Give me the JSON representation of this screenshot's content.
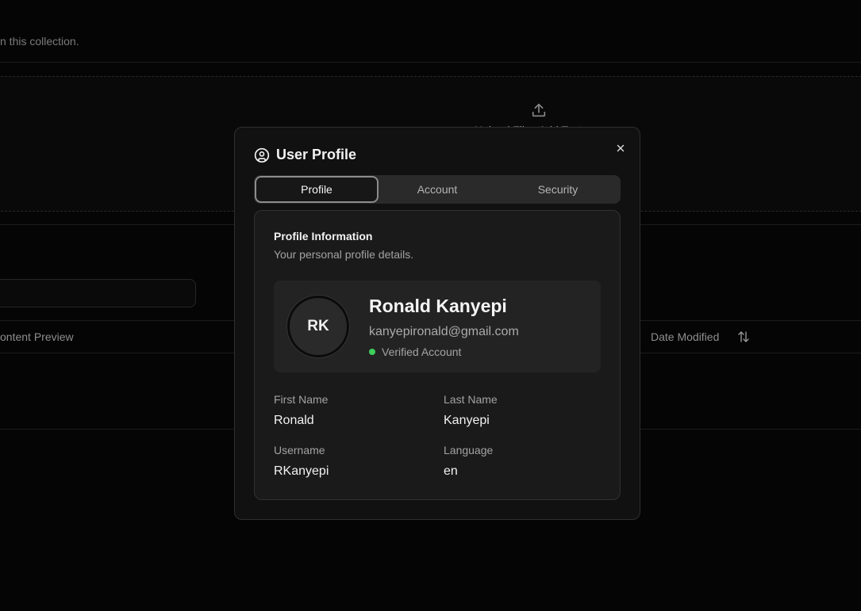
{
  "background": {
    "collection_description": "n this collection.",
    "upload_text": "Upload Files    Add Text",
    "table_headers": {
      "content_preview": "ontent Preview",
      "date_modified": "Date Modified"
    }
  },
  "modal": {
    "title": "User Profile",
    "tabs": [
      {
        "label": "Profile",
        "active": true
      },
      {
        "label": "Account",
        "active": false
      },
      {
        "label": "Security",
        "active": false
      }
    ],
    "card": {
      "title": "Profile Information",
      "description": "Your personal profile details.",
      "avatar_initials": "RK",
      "full_name": "Ronald Kanyepi",
      "email": "kanyepironald@gmail.com",
      "verification_status": "Verified Account",
      "fields": {
        "first_name": {
          "label": "First Name",
          "value": "Ronald"
        },
        "last_name": {
          "label": "Last Name",
          "value": "Kanyepi"
        },
        "username": {
          "label": "Username",
          "value": "RKanyepi"
        },
        "language": {
          "label": "Language",
          "value": "en"
        }
      }
    }
  },
  "colors": {
    "verified": "#3ecf5a",
    "modal_bg": "#111111",
    "card_bg": "#1a1a1a"
  }
}
